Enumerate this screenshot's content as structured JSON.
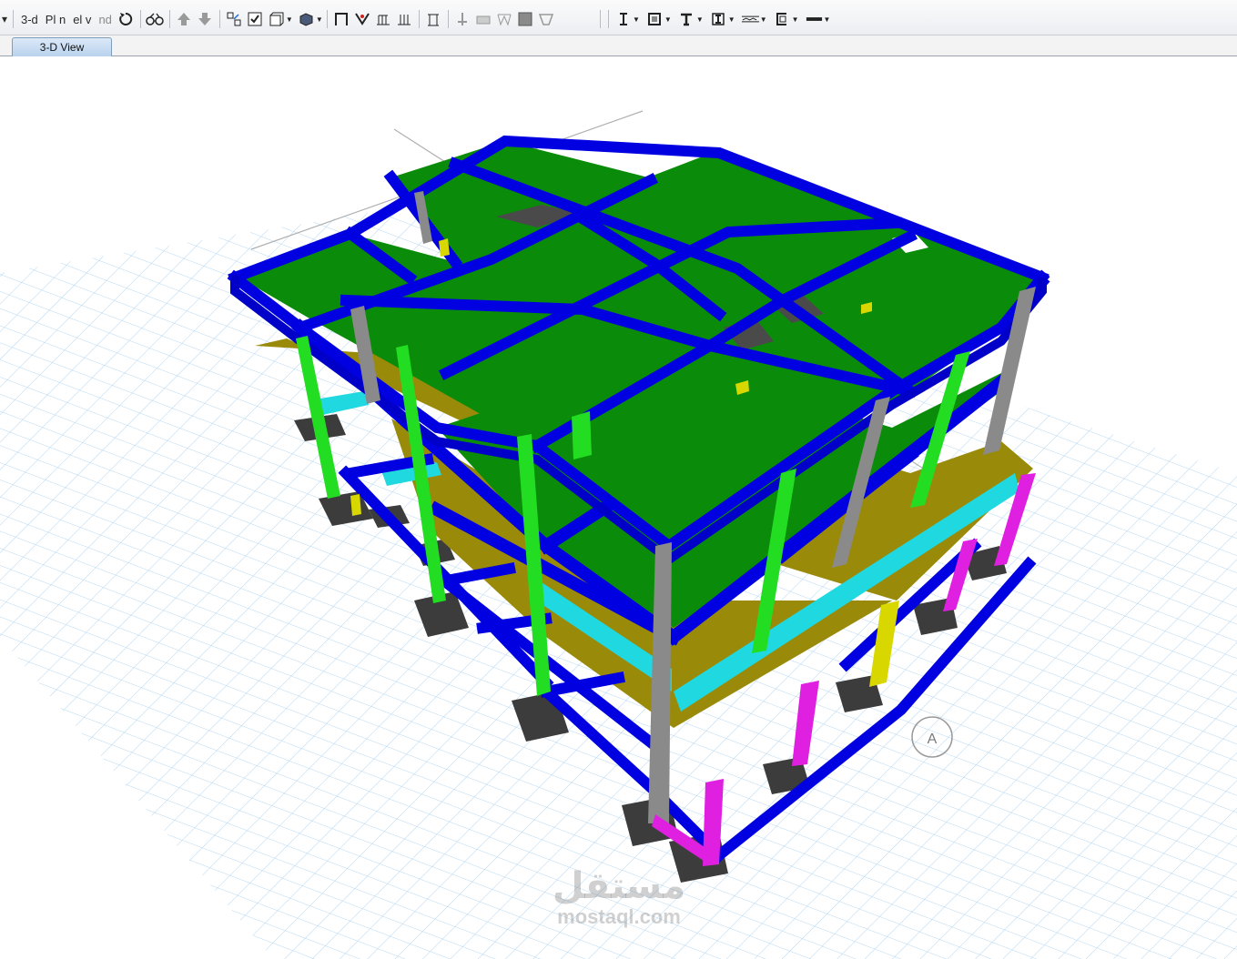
{
  "toolbar": {
    "view_3d_label": "3-d",
    "view_plan_label": "Pl n",
    "view_elev_label": "el v",
    "view_nd_label": "nd"
  },
  "tabs": [
    {
      "label": "3-D View",
      "active": true
    }
  ],
  "compass": {
    "label": "A"
  },
  "watermark": {
    "arabic": "مستقل",
    "latin": "mostaql.com"
  },
  "colors": {
    "slab": "#0a8c0a",
    "beam": "#0000e0",
    "column_gray": "#8a8a8a",
    "column_green": "#22dd22",
    "column_magenta": "#e020e0",
    "column_yellow": "#d8d800",
    "ground_slab": "#9a8a0a",
    "cyan_strip": "#20d8e0",
    "footing": "#3c3c3c",
    "grid": "#a8d0f0"
  }
}
